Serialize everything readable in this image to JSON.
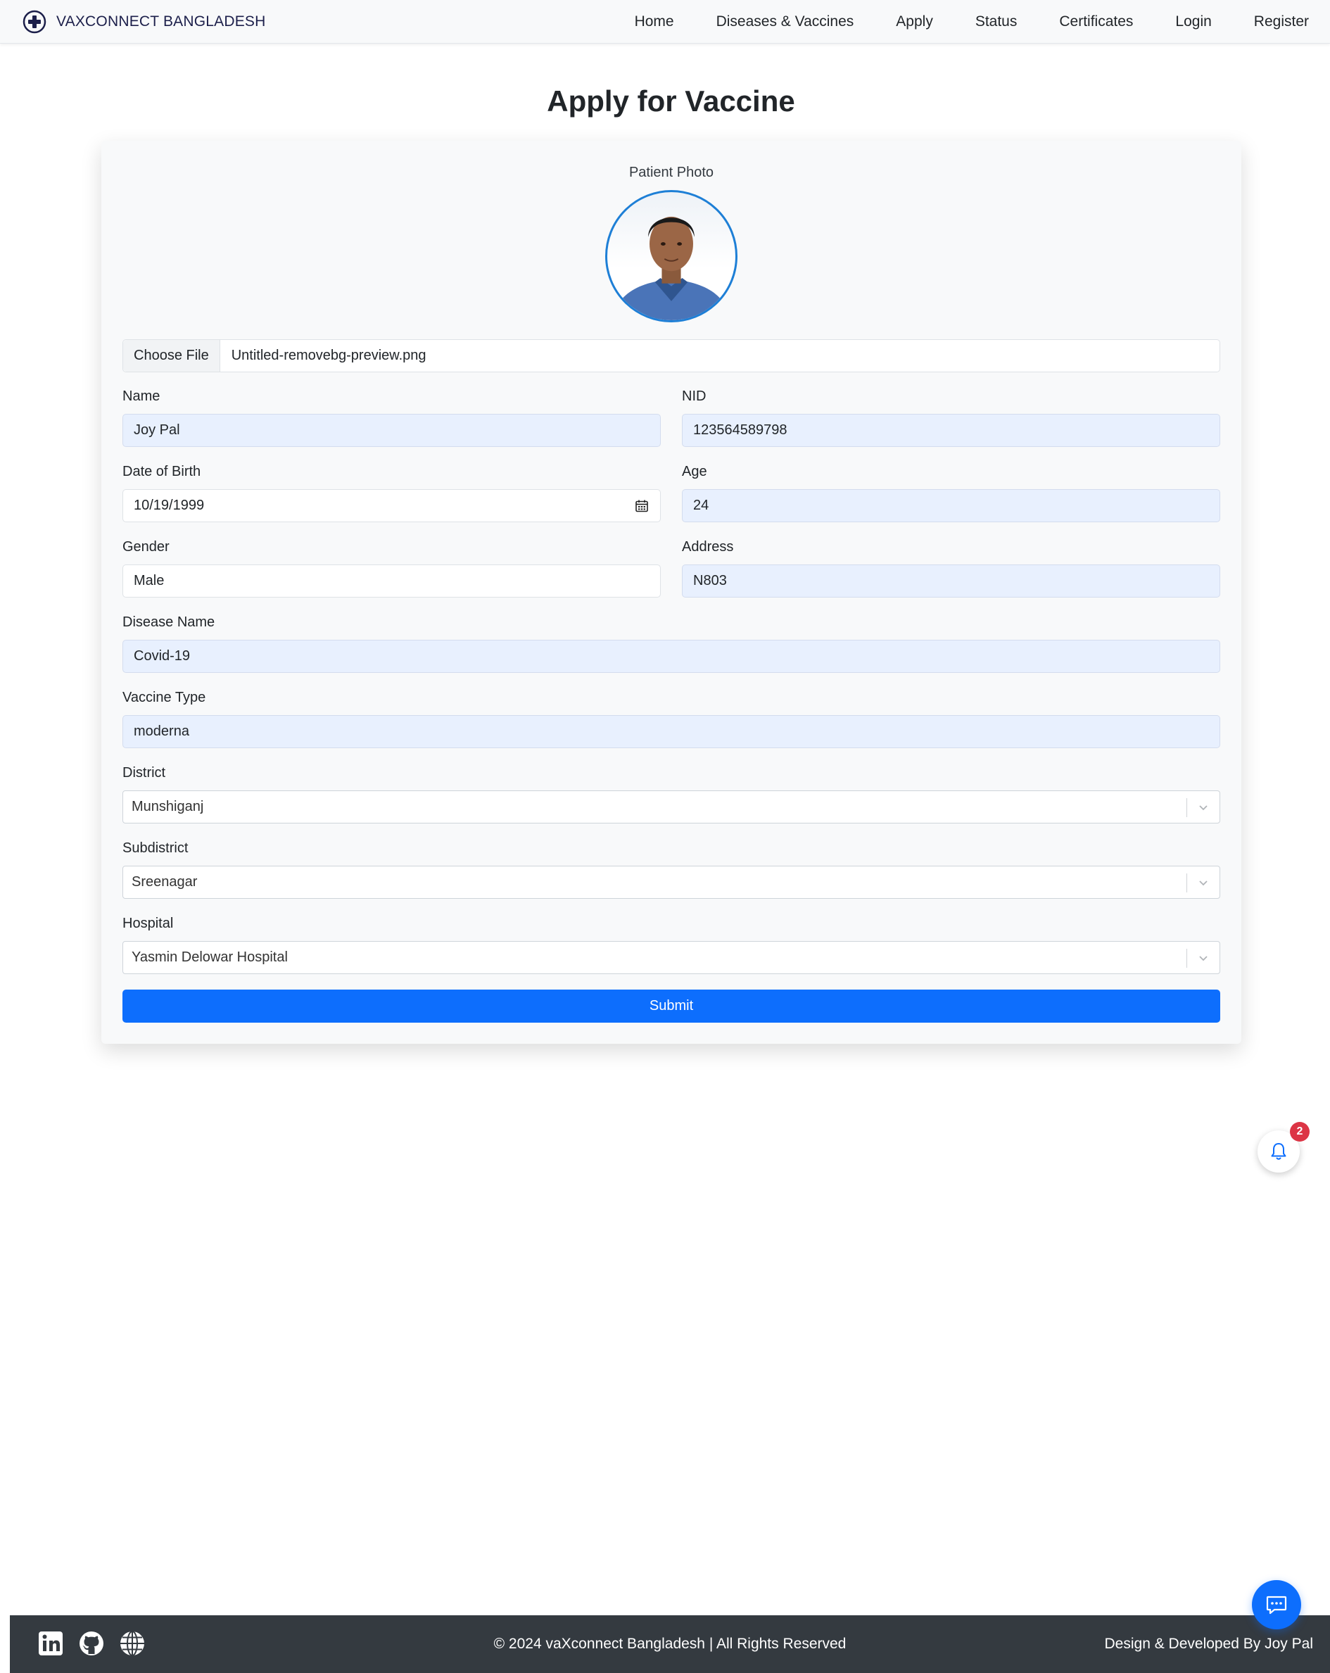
{
  "navbar": {
    "brand": "VAXCONNECT BANGLADESH",
    "links": [
      "Home",
      "Diseases & Vaccines",
      "Apply",
      "Status",
      "Certificates",
      "Login",
      "Register"
    ]
  },
  "page": {
    "title": "Apply for Vaccine"
  },
  "form": {
    "photo_label": "Patient Photo",
    "file": {
      "button_label": "Choose File",
      "file_name": "Untitled-removebg-preview.png"
    },
    "name": {
      "label": "Name",
      "value": "Joy Pal"
    },
    "nid": {
      "label": "NID",
      "value": "123564589798"
    },
    "dob": {
      "label": "Date of Birth",
      "value": "10/19/1999"
    },
    "age": {
      "label": "Age",
      "value": "24"
    },
    "gender": {
      "label": "Gender",
      "value": "Male"
    },
    "address": {
      "label": "Address",
      "value": "N803"
    },
    "disease": {
      "label": "Disease Name",
      "value": "Covid-19"
    },
    "vaccine": {
      "label": "Vaccine Type",
      "value": "moderna"
    },
    "district": {
      "label": "District",
      "value": "Munshiganj"
    },
    "subdistrict": {
      "label": "Subdistrict",
      "value": "Sreenagar"
    },
    "hospital": {
      "label": "Hospital",
      "value": "Yasmin Delowar Hospital"
    },
    "submit_label": "Submit"
  },
  "notifications": {
    "count": "2"
  },
  "footer": {
    "social_icons": [
      "linkedin-icon",
      "github-icon",
      "globe-icon"
    ],
    "copyright": "© 2024 vaXconnect Bangladesh | All Rights Reserved",
    "credit": "Design & Developed By Joy Pal"
  },
  "colors": {
    "primary": "#0d6efd",
    "navbar_bg": "#f8f9fa",
    "autofill_bg": "#e8f0fe",
    "badge": "#dc3545",
    "footer_bg": "#343a40",
    "avatar_border": "#1e7fd6"
  }
}
